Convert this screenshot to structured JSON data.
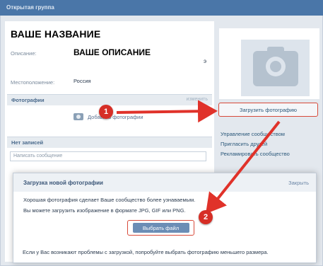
{
  "window": {
    "title": "Открытая группа"
  },
  "group": {
    "name": "ВАШЕ НАЗВАНИЕ",
    "description_label": "Описание:",
    "description_value": "ВАШЕ ОПИСАНИЕ",
    "location_label": "Местоположение:",
    "location_value": "Россия",
    "side_marker": "э"
  },
  "photos_section": {
    "title": "Фотографии",
    "right_link": "изменить",
    "add_photo_label": "Добавить фотографии"
  },
  "wall_section": {
    "title": "Нет записей",
    "input_placeholder": "Написать сообщение"
  },
  "sidebar": {
    "upload_photo_button": "Загрузить фотографию",
    "menu": [
      "Управление сообществом",
      "Пригласить друзей",
      "Рекламировать сообщество"
    ]
  },
  "upload_modal": {
    "title": "Загрузка новой фотографии",
    "close_label": "Закрыть",
    "line1": "Хорошая фотография сделает Ваше сообщество более узнаваемым.",
    "line2": "Вы можете загрузить изображение в формате JPG, GIF или PNG.",
    "choose_file_button": "Выбрать файл",
    "footer_text": "Если у Вас возникают проблемы с загрузкой, попробуйте выбрать фотографию меньшего размера."
  },
  "annotations": {
    "step1": "1",
    "step2": "2",
    "highlight_color": "#d84a3a",
    "badge_color": "#d62e26"
  },
  "icons": {
    "camera_small": "camera-icon",
    "camera_avatar": "camera-placeholder-icon"
  }
}
